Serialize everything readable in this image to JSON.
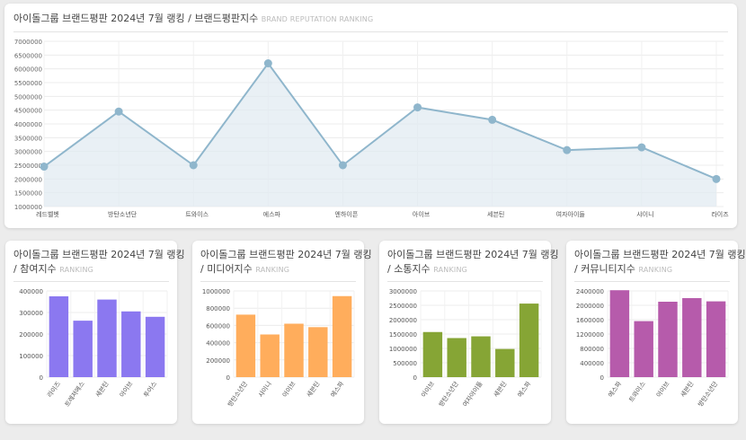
{
  "main": {
    "title": "아이돌그룹 브랜드평판 2024년 7월 랭킹 / 브랜드평판지수",
    "subtitle": "BRAND REPUTATION RANKING"
  },
  "panels": [
    {
      "title_line1": "아이돌그룹 브랜드평판 2024년 7월 랭킹",
      "title_line2": "/ 참여지수",
      "subtitle": "RANKING"
    },
    {
      "title_line1": "아이돌그룹 브랜드평판 2024년 7월 랭킹",
      "title_line2": "/ 미디어지수",
      "subtitle": "RANKING"
    },
    {
      "title_line1": "아이돌그룹 브랜드평판 2024년 7월 랭킹",
      "title_line2": "/ 소통지수",
      "subtitle": "RANKING"
    },
    {
      "title_line1": "아이돌그룹 브랜드평판 2024년 7월 랭킹",
      "title_line2": "/ 커뮤니티지수",
      "subtitle": "RANKING"
    }
  ],
  "chart_data": [
    {
      "type": "area",
      "title": "아이돌그룹 브랜드평판 2024년 7월 랭킹 / 브랜드평판지수",
      "categories": [
        "레드벨벳",
        "방탄소년단",
        "트와이스",
        "에스파",
        "엔하이픈",
        "아이브",
        "세븐틴",
        "여자아이들",
        "샤이니",
        "라이즈"
      ],
      "values": [
        2450000,
        4450000,
        2500000,
        6200000,
        2500000,
        4600000,
        4150000,
        3050000,
        3150000,
        2000000
      ],
      "ylim": [
        1000000,
        7000000
      ],
      "yticks": [
        "1000000",
        "1500000",
        "2000000",
        "2500000",
        "3000000",
        "3500000",
        "4000000",
        "4500000",
        "5000000",
        "5500000",
        "6000000",
        "6500000",
        "7000000"
      ],
      "color": "#8fb6cc",
      "grid": true
    },
    {
      "type": "bar",
      "title": "아이돌그룹 브랜드평판 2024년 7월 랭킹 / 참여지수",
      "categories": [
        "라이즈",
        "트레져에스",
        "세븐틴",
        "아이브",
        "투어스"
      ],
      "values": [
        375000,
        262000,
        360000,
        305000,
        280000
      ],
      "ylim": [
        0,
        400000
      ],
      "yticks": [
        "0",
        "100000",
        "200000",
        "300000",
        "400000"
      ],
      "color": "#8b78f0"
    },
    {
      "type": "bar",
      "title": "아이돌그룹 브랜드평판 2024년 7월 랭킹 / 미디어지수",
      "categories": [
        "방탄소년단",
        "샤이니",
        "아이브",
        "세븐틴",
        "에스파"
      ],
      "values": [
        725000,
        495000,
        620000,
        580000,
        940000
      ],
      "ylim": [
        0,
        1000000
      ],
      "yticks": [
        "0",
        "200000",
        "400000",
        "600000",
        "800000",
        "1000000"
      ],
      "color": "#ffad5c"
    },
    {
      "type": "bar",
      "title": "아이돌그룹 브랜드평판 2024년 7월 랭킹 / 소통지수",
      "categories": [
        "아이브",
        "방탄소년단",
        "여자아이들",
        "세븐틴",
        "에스파"
      ],
      "values": [
        1570000,
        1360000,
        1420000,
        980000,
        2560000
      ],
      "ylim": [
        0,
        3000000
      ],
      "yticks": [
        "0",
        "500000",
        "1000000",
        "1500000",
        "2000000",
        "2500000",
        "3000000"
      ],
      "color": "#86a535"
    },
    {
      "type": "bar",
      "title": "아이돌그룹 브랜드평판 2024년 7월 랭킹 / 커뮤니티지수",
      "categories": [
        "에스파",
        "트와이스",
        "아이브",
        "세븐틴",
        "방탄소년단"
      ],
      "values": [
        2420000,
        1560000,
        2100000,
        2200000,
        2110000
      ],
      "ylim": [
        0,
        2400000
      ],
      "yticks": [
        "0",
        "400000",
        "800000",
        "1200000",
        "1600000",
        "2000000",
        "2400000"
      ],
      "color": "#b65bab"
    }
  ]
}
